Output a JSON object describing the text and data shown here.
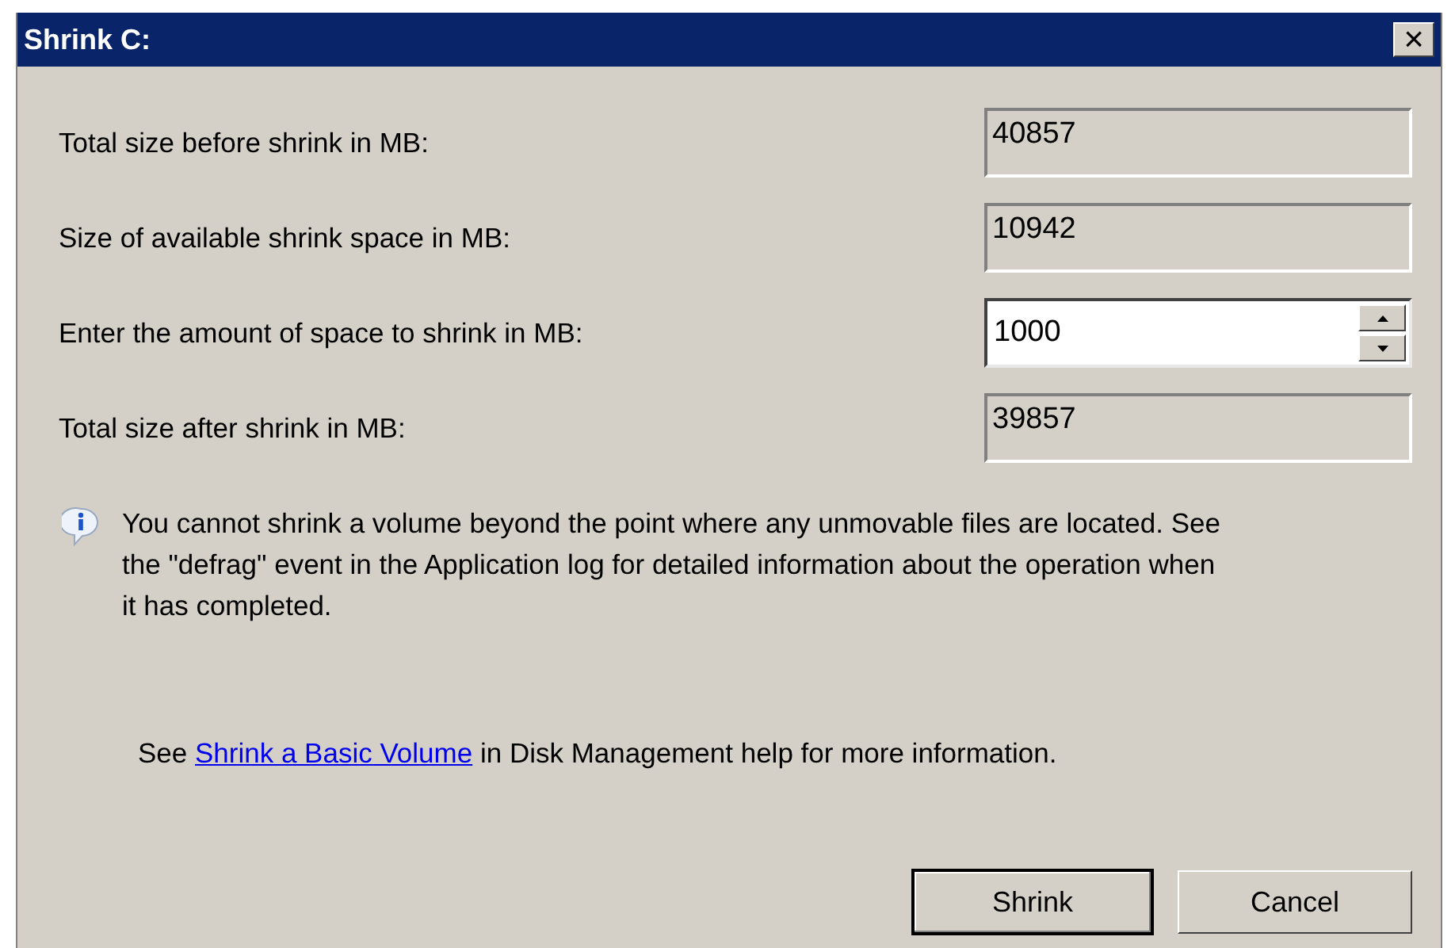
{
  "window": {
    "title": "Shrink C:",
    "close": "×"
  },
  "fields": [
    {
      "label": "Total size before shrink in MB:",
      "kind": "readonly",
      "value": "40857"
    },
    {
      "label": "Size of available shrink space in MB:",
      "kind": "readonly",
      "value": "10942"
    },
    {
      "label": "Enter the amount of space to shrink in MB:",
      "kind": "spin",
      "value": "1000"
    },
    {
      "label": "Total size after shrink in MB:",
      "kind": "readonly",
      "value": "39857"
    }
  ],
  "info": "You cannot shrink a volume beyond the point where any unmovable files are located. See the \"defrag\" event in the Application log for detailed information about the operation when it has completed.",
  "help": {
    "before": "See",
    "link": "Shrink a Basic Volume",
    "after": "in Disk Management help for more information."
  },
  "buttons": [
    {
      "label": "Shrink",
      "default": true
    },
    {
      "label": "Cancel",
      "default": false
    }
  ]
}
